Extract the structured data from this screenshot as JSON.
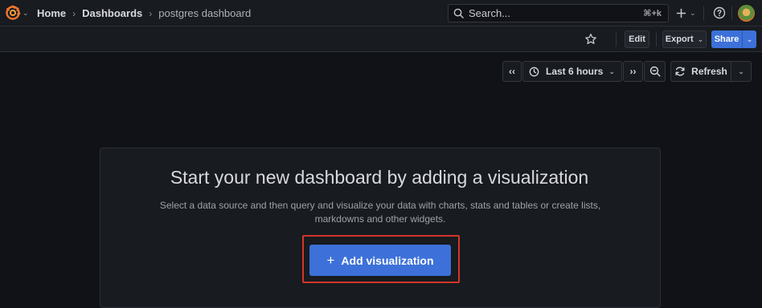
{
  "breadcrumb": {
    "home": "Home",
    "dashboards": "Dashboards",
    "current": "postgres dashboard",
    "separator": "›"
  },
  "search": {
    "placeholder": "Search...",
    "shortcut": "⌘+k"
  },
  "topbar": {
    "add_icon": "plus-icon",
    "help_icon": "help-circle-icon"
  },
  "toolbar": {
    "edit_label": "Edit",
    "export_label": "Export",
    "export_caret": "⌄",
    "share_label": "Share",
    "share_caret": "⌄"
  },
  "time_controls": {
    "back_label": "‹‹",
    "range_label": "Last 6 hours",
    "range_caret": "⌄",
    "forward_label": "››",
    "refresh_label": "Refresh",
    "refresh_caret": "⌄"
  },
  "empty_state": {
    "title": "Start your new dashboard by adding a visualization",
    "description": "Select a data source and then query and visualize your data with charts, stats and tables or create lists, markdowns and other widgets.",
    "button_plus": "+",
    "button_label": "Add visualization"
  },
  "colors": {
    "background": "#111217",
    "accent": "#3d71d9",
    "highlight": "#d2362b",
    "logo": "#f2762e"
  }
}
